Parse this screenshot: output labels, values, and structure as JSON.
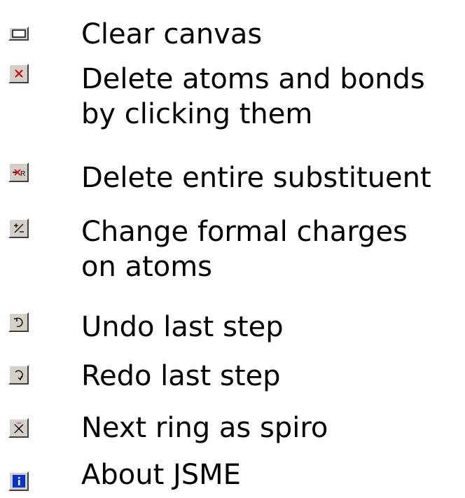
{
  "items": [
    {
      "icon": "clear-canvas-icon",
      "label": "Clear canvas",
      "label2": ""
    },
    {
      "icon": "delete-icon",
      "label": "Delete atoms and bonds",
      "label2": "by clicking them"
    },
    {
      "icon": "delete-substituent-icon",
      "label": "Delete entire substituent",
      "label2": ""
    },
    {
      "icon": "charge-icon",
      "label": "Change formal charges",
      "label2": "on atoms"
    },
    {
      "icon": "undo-icon",
      "label": "Undo last step",
      "label2": ""
    },
    {
      "icon": "redo-icon",
      "label": "Redo last step",
      "label2": ""
    },
    {
      "icon": "spiro-icon",
      "label": "Next ring as spiro",
      "label2": ""
    },
    {
      "icon": "info-icon",
      "label": "About JSME",
      "label2": ""
    }
  ],
  "colors": {
    "delete_red": "#e00000",
    "info_blue": "#0033cc",
    "spiro_magenta": "#cc00cc",
    "button_face": "#d4d0c8"
  }
}
